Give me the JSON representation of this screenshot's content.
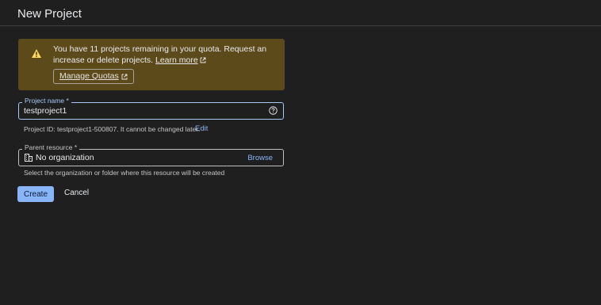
{
  "dialog": {
    "title": "New Project"
  },
  "quota_notice": {
    "text": "You have 11 projects remaining in your quota. Request an increase or delete projects.",
    "learn_more": "Learn more",
    "manage_button": "Manage Quotas",
    "colors": {
      "background": "#5c4a1a",
      "icon": "#fdd663"
    }
  },
  "project_name": {
    "label": "Project name *",
    "value": "testproject1",
    "help_icon": "help-circle-icon"
  },
  "project_id": {
    "text": "Project ID: testproject1-500807. It cannot be changed later.",
    "edit_label": "Edit"
  },
  "parent_resource": {
    "label": "Parent resource *",
    "value": "No organization",
    "browse_label": "Browse",
    "hint": "Select the organization or folder where this resource will be created",
    "icon": "building-icon"
  },
  "actions": {
    "create": "Create",
    "cancel": "Cancel"
  },
  "theme": {
    "accent": "#8ab4f8",
    "background": "#1f1f1f"
  }
}
